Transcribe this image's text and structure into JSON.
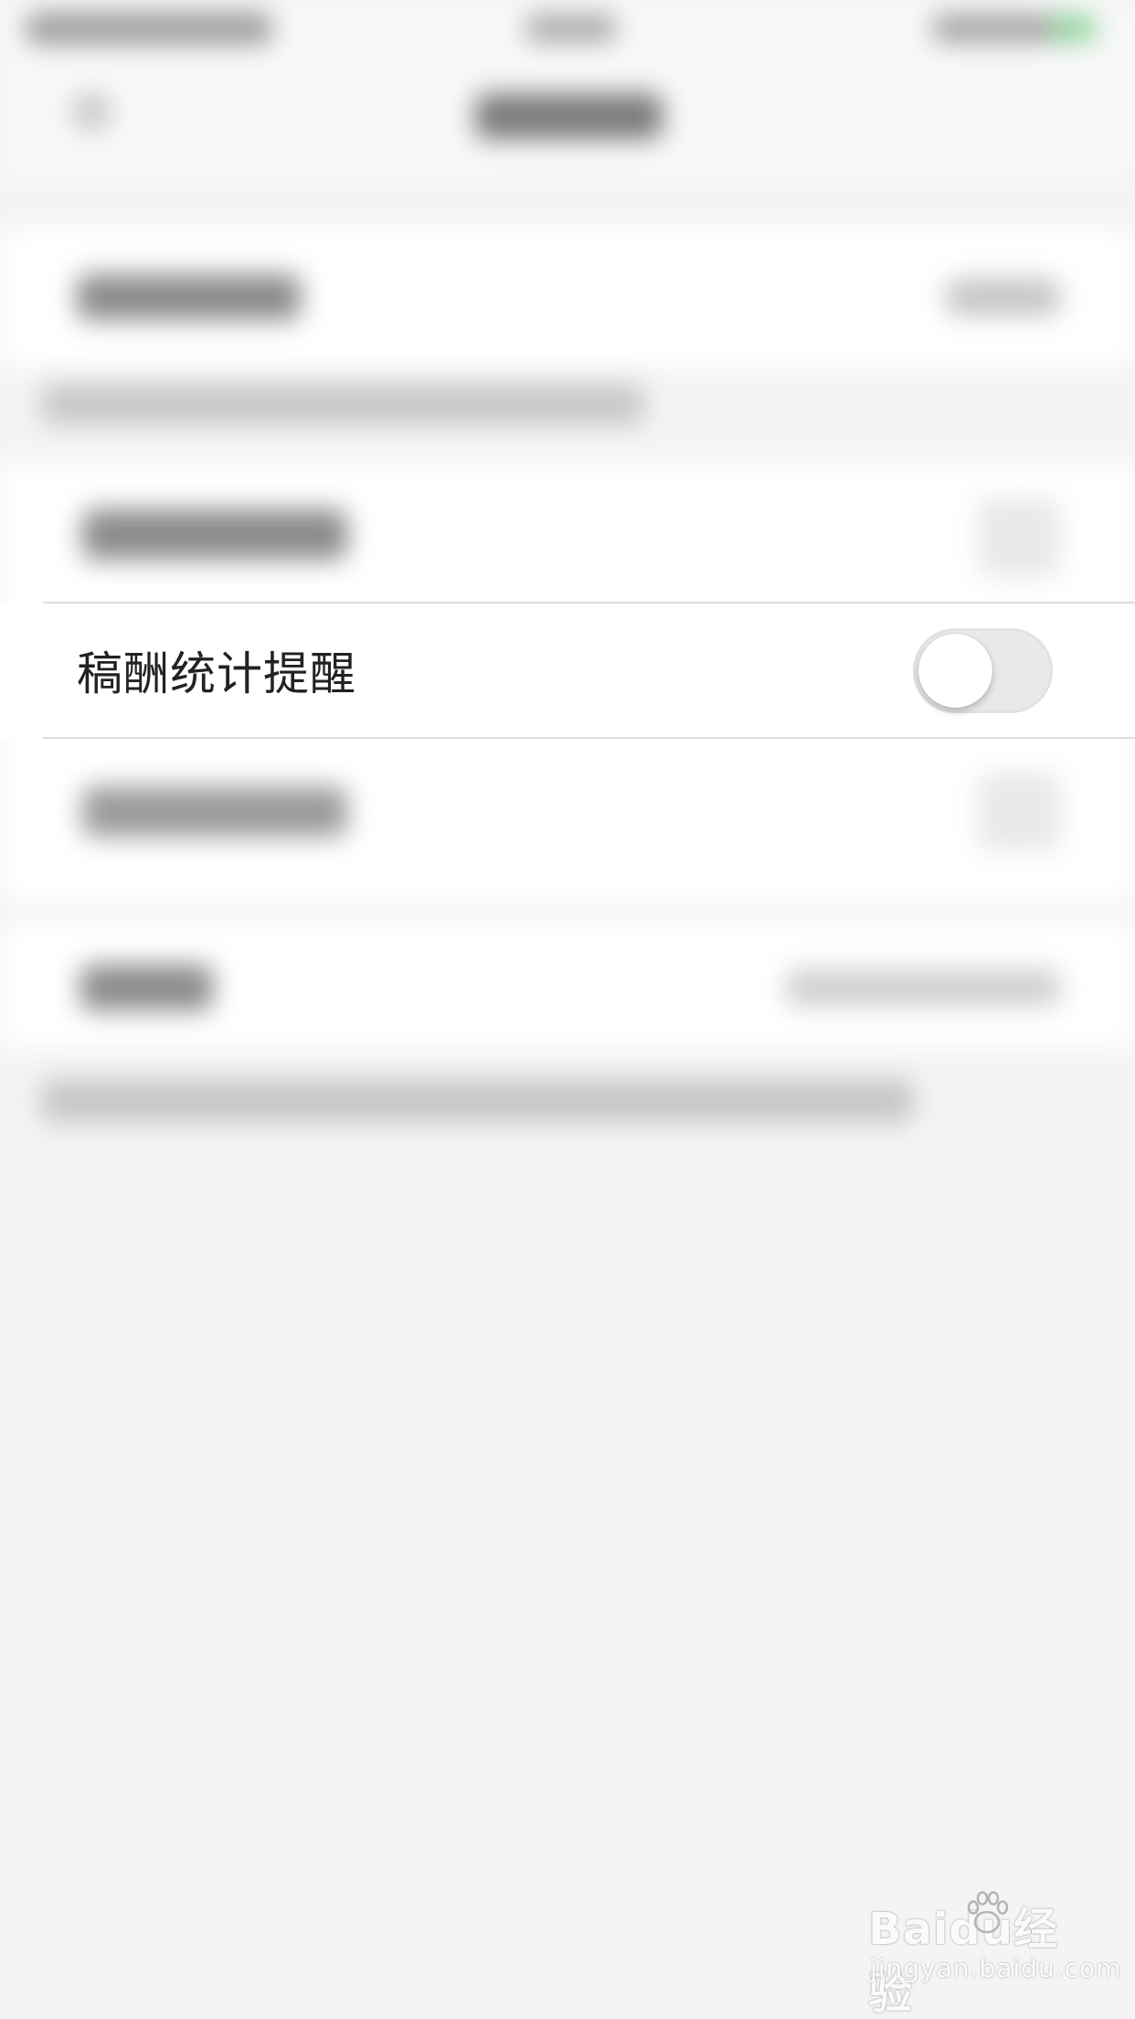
{
  "settings": {
    "focused_row": {
      "label": "稿酬统计提醒",
      "toggle_on": false
    }
  },
  "watermark": {
    "brand": "Baidu经验",
    "url": "jingyan.baidu.com"
  },
  "colors": {
    "background": "#f4f4f4",
    "row_background": "#ffffff",
    "toggle_off_track": "#e9e9ea",
    "accent_green": "#4cd964"
  }
}
